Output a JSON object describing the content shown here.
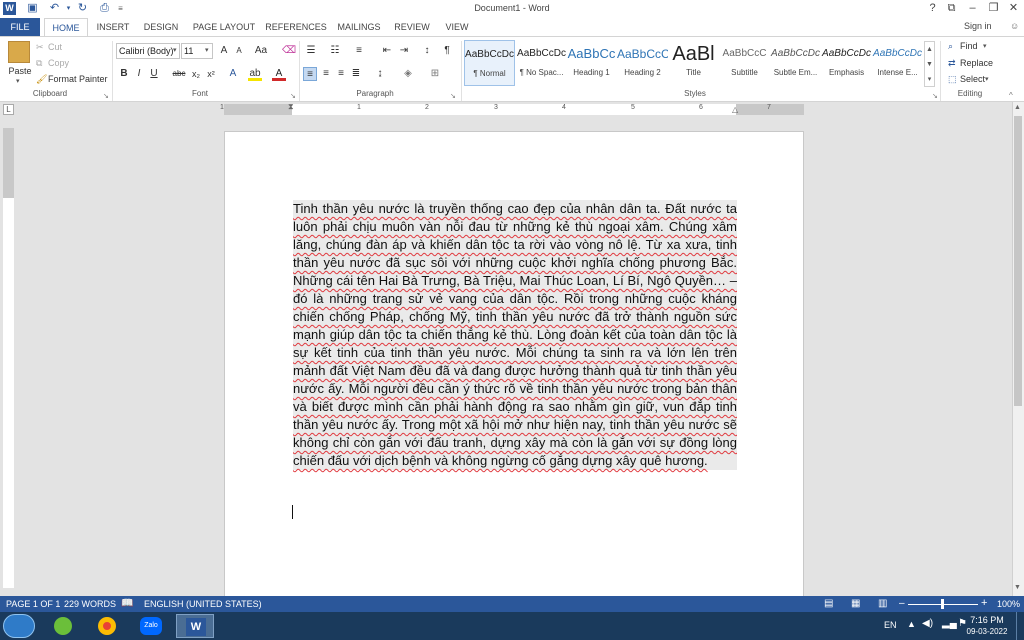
{
  "window": {
    "title": "Document1 - Word",
    "signin": "Sign in"
  },
  "tabs": [
    {
      "label": "FILE"
    },
    {
      "label": "HOME"
    },
    {
      "label": "INSERT"
    },
    {
      "label": "DESIGN"
    },
    {
      "label": "PAGE LAYOUT"
    },
    {
      "label": "REFERENCES"
    },
    {
      "label": "MAILINGS"
    },
    {
      "label": "REVIEW"
    },
    {
      "label": "VIEW"
    }
  ],
  "clipboard": {
    "paste": "Paste",
    "cut": "Cut",
    "copy": "Copy",
    "format_painter": "Format Painter",
    "label": "Clipboard"
  },
  "font": {
    "name": "Calibri (Body)",
    "size": "11",
    "label": "Font"
  },
  "paragraph": {
    "label": "Paragraph"
  },
  "styles": {
    "label": "Styles",
    "items": [
      {
        "preview": "AaBbCcDc",
        "name": "¶ Normal"
      },
      {
        "preview": "AaBbCcDc",
        "name": "¶ No Spac..."
      },
      {
        "preview": "AaBbCc",
        "name": "Heading 1"
      },
      {
        "preview": "AaBbCcC",
        "name": "Heading 2"
      },
      {
        "preview": "AaBl",
        "name": "Title"
      },
      {
        "preview": "AaBbCcC",
        "name": "Subtitle"
      },
      {
        "preview": "AaBbCcDc",
        "name": "Subtle Em..."
      },
      {
        "preview": "AaBbCcDc",
        "name": "Emphasis"
      },
      {
        "preview": "AaBbCcDc",
        "name": "Intense E..."
      }
    ]
  },
  "editing": {
    "find": "Find",
    "replace": "Replace",
    "select": "Select",
    "label": "Editing"
  },
  "ruler": {
    "marks": [
      "1",
      "1",
      "2",
      "3",
      "4",
      "5",
      "6",
      "7"
    ]
  },
  "document": {
    "body": "Tinh thần yêu nước là truyền thống cao đẹp của nhân dân ta. Đất nước ta luôn phải chịu muôn vàn nỗi đau từ những kẻ thù ngoại xâm. Chúng xâm lăng, chúng đàn áp và khiến dân tộc ta rời vào vòng nô lệ. Từ xa xưa, tinh thần yêu nước đã sục sôi với những cuộc khởi nghĩa chống phương Bắc. Những cái tên Hai Bà Trưng, Bà Triệu, Mai Thúc Loan, Lí Bí, Ngô Quyền… – đó là những trang sử vẻ vang của dân tộc. Rồi trong những cuộc kháng chiến chống Pháp, chống Mỹ, tinh thần yêu nước đã trở thành nguồn sức mạnh giúp dân tộc ta chiến thắng kẻ thù. Lòng đoàn kết của toàn dân tộc là sự kết tinh của tinh thần yêu nước. Mỗi chúng ta sinh ra và lớn lên trên mảnh đất Việt Nam đều đã và đang được hưởng thành quả từ tinh thần yêu nước ấy. Mỗi người đều cần ý thức rõ về tinh thần yêu nước trong bản thân và biết được mình cần phải hành động ra sao nhằm gìn giữ, vun đắp tinh thần yêu nước ấy. Trong một xã hội mở như hiện nay, tinh thần yêu nước sẽ không chỉ còn gắn với đấu tranh, dựng xây mà còn là gắn với sự đồng lòng chiến đấu với dịch bệnh và không ngừng cố gắng dựng xây quê hương."
  },
  "status": {
    "page": "PAGE 1 OF 1",
    "words": "229 WORDS",
    "language": "ENGLISH (UNITED STATES)",
    "zoom": "100%"
  },
  "taskbar": {
    "apps": [
      {
        "name": "Zalo"
      }
    ],
    "lang": "EN",
    "time": "7:16 PM",
    "date": "09-03-2022"
  }
}
